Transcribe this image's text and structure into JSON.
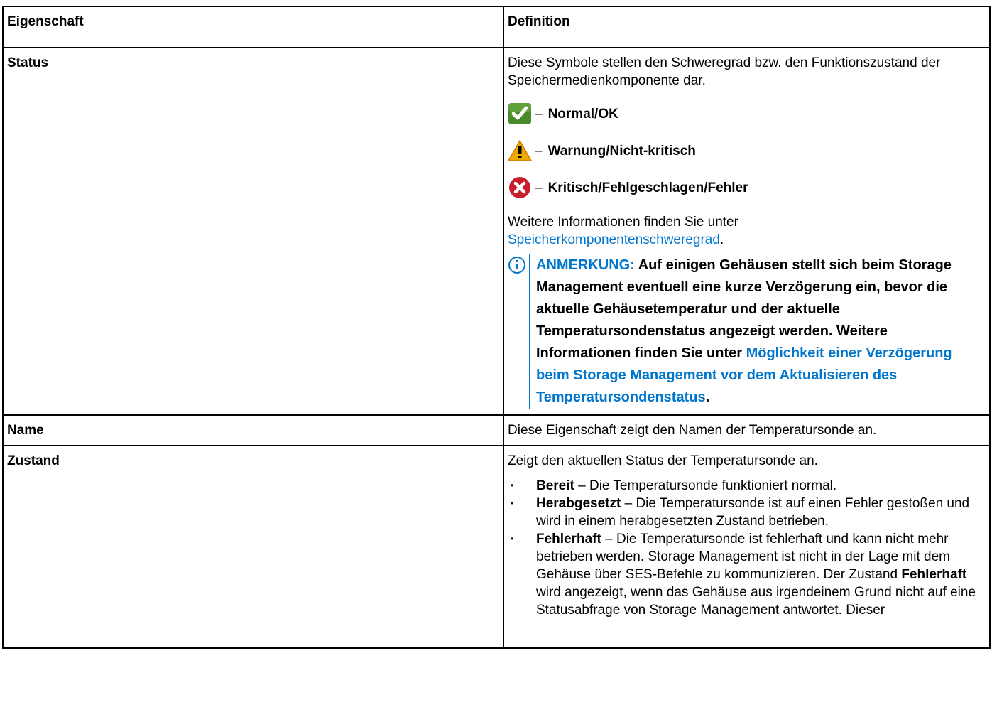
{
  "header": {
    "col1": "Eigenschaft",
    "col2": "Definition"
  },
  "status_row": {
    "name": "Status",
    "intro": "Diese Symbole stellen den Schweregrad bzw. den Funktionszustand der Speichermedienkomponente dar.",
    "dash": "–",
    "items": [
      {
        "icon": "check-icon",
        "label": "Normal/OK",
        "color": "#4a8a2a"
      },
      {
        "icon": "warning-icon",
        "label": "Warnung/Nicht-kritisch",
        "color": "#f0a800"
      },
      {
        "icon": "error-icon",
        "label": "Kritisch/Fehlgeschlagen/Fehler",
        "color": "#c8202a"
      }
    ],
    "more_prefix": "Weitere Informationen finden Sie unter",
    "more_link": "Speicherkomponentenschweregrad",
    "more_suffix": ".",
    "note": {
      "label": "ANMERKUNG:",
      "text": "Auf einigen Gehäusen stellt sich beim Storage Management eventuell eine kurze Verzögerung ein, bevor die aktuelle Gehäusetemperatur und der aktuelle Temperatursondenstatus angezeigt werden. Weitere Informationen finden Sie unter",
      "link": "Möglichkeit einer Verzögerung beim Storage Management vor dem Aktualisieren des Temperatursondenstatus",
      "suffix": "."
    }
  },
  "name_row": {
    "name": "Name",
    "text": "Diese Eigenschaft zeigt den Namen der Temperatursonde an."
  },
  "zustand_row": {
    "name": "Zustand",
    "intro": "Zeigt den aktuellen Status der Temperatursonde an.",
    "items": [
      {
        "term": "Bereit",
        "text": " – Die Temperatursonde funktioniert normal."
      },
      {
        "term": "Herabgesetzt",
        "text": " – Die Temperatursonde ist auf einen Fehler gestoßen und wird in einem herabgesetzten Zustand betrieben."
      },
      {
        "term": "Fehlerhaft",
        "text": " – Die Temperatursonde ist fehlerhaft und kann nicht mehr betrieben werden. Storage Management ist nicht in der Lage mit dem Gehäuse über SES-Befehle zu kommunizieren. Der Zustand ",
        "term2": "Fehlerhaft",
        "text2": " wird angezeigt, wenn das Gehäuse aus irgendeinem Grund nicht auf eine Statusabfrage von Storage Management antwortet. Dieser"
      }
    ]
  },
  "colors": {
    "link": "#0076ce",
    "border": "#000000"
  }
}
